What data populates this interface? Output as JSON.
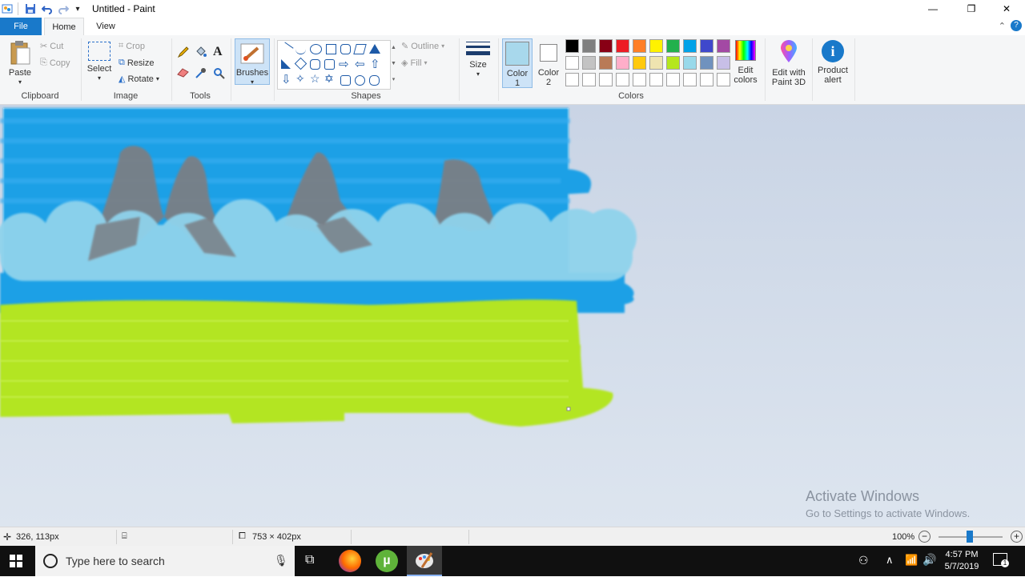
{
  "window": {
    "title": "Untitled - Paint",
    "controls": {
      "minimize": "—",
      "restore": "❐",
      "close": "✕"
    },
    "qat_dropdown": "▾"
  },
  "tabs": [
    {
      "label": "File"
    },
    {
      "label": "Home"
    },
    {
      "label": "View"
    }
  ],
  "ribbon": {
    "clipboard": {
      "paste": "Paste",
      "cut": "Cut",
      "copy": "Copy",
      "label": "Clipboard"
    },
    "image": {
      "select": "Select",
      "crop": "Crop",
      "resize": "Resize",
      "rotate": "Rotate",
      "label": "Image"
    },
    "tools": {
      "label": "Tools",
      "text_tool": "A"
    },
    "brushes": {
      "label": "Brushes"
    },
    "shapes": {
      "outline": "Outline",
      "fill": "Fill",
      "label": "Shapes"
    },
    "size": {
      "label": "Size"
    },
    "colors": {
      "color1_line1": "Color",
      "color1_line2": "1",
      "color2_line1": "Color",
      "color2_line2": "2",
      "edit_line1": "Edit",
      "edit_line2": "colors",
      "label": "Colors",
      "color1": "#a8d8ec",
      "color2": "#ffffff",
      "palette_row1": [
        "#000000",
        "#7f7f7f",
        "#880015",
        "#ed1c24",
        "#ff7f27",
        "#fff200",
        "#22b14c",
        "#00a2e8",
        "#3f48cc",
        "#a349a4"
      ],
      "palette_row2": [
        "#ffffff",
        "#c3c3c3",
        "#b97a57",
        "#ffaec9",
        "#ffc90e",
        "#efe4b0",
        "#b5e61d",
        "#99d9ea",
        "#7092be",
        "#c8bfe7"
      ],
      "palette_row3": [
        "#ffffff",
        "#ffffff",
        "#ffffff",
        "#ffffff",
        "#ffffff",
        "#ffffff",
        "#ffffff",
        "#ffffff",
        "#ffffff",
        "#ffffff"
      ]
    },
    "paint3d": {
      "line1": "Edit with",
      "line2": "Paint 3D"
    },
    "product_alert": {
      "line1": "Product",
      "line2": "alert"
    }
  },
  "statusbar": {
    "cursor_pos": "326, 113px",
    "image_size": "753 × 402px",
    "zoom": "100%",
    "zoom_fraction": 0.5
  },
  "watermark": {
    "title": "Activate Windows",
    "subtitle": "Go to Settings to activate Windows."
  },
  "taskbar": {
    "search_placeholder": "Type here to search",
    "time": "4:57 PM",
    "date": "5/7/2019",
    "notification_count": "1"
  }
}
